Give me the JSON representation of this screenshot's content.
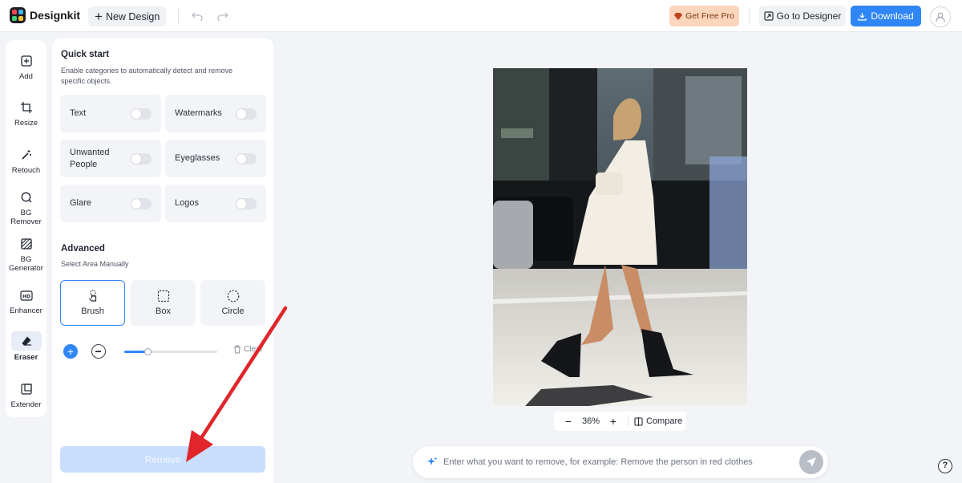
{
  "app": {
    "name": "Designkit"
  },
  "topbar": {
    "new_design_label": "New Design",
    "get_pro_label": "Get Free Pro",
    "go_to_designer_label": "Go to Designer",
    "download_label": "Download"
  },
  "rail": {
    "items": [
      {
        "label": "Add",
        "icon": "add-square-icon"
      },
      {
        "label": "Resize",
        "icon": "crop-icon"
      },
      {
        "label": "Retouch",
        "icon": "magic-wand-icon"
      },
      {
        "label": "BG Remover",
        "icon": "bg-remover-icon"
      },
      {
        "label": "BG Generator",
        "icon": "bg-generator-icon"
      },
      {
        "label": "Enhancer",
        "icon": "hd-icon"
      },
      {
        "label": "Eraser",
        "icon": "eraser-icon",
        "active": true
      },
      {
        "label": "Extender",
        "icon": "extender-icon"
      }
    ]
  },
  "panel": {
    "quick_start_title": "Quick start",
    "quick_start_desc": "Enable categories to automatically detect and remove specific objects.",
    "categories": [
      {
        "label": "Text",
        "enabled": false
      },
      {
        "label": "Watermarks",
        "enabled": false
      },
      {
        "label": "Unwanted People",
        "enabled": false
      },
      {
        "label": "Eyeglasses",
        "enabled": false
      },
      {
        "label": "Glare",
        "enabled": false
      },
      {
        "label": "Logos",
        "enabled": false
      }
    ],
    "advanced_title": "Advanced",
    "advanced_desc": "Select Area Manually",
    "modes": [
      {
        "label": "Brush",
        "icon": "hand-brush-icon",
        "active": true
      },
      {
        "label": "Box",
        "icon": "dashed-square-icon"
      },
      {
        "label": "Circle",
        "icon": "dashed-circle-icon"
      }
    ],
    "brush_size_fraction": 0.25,
    "clear_label": "Clear",
    "remove_label": "Remove"
  },
  "canvas": {
    "zoom_label": "36%",
    "compare_label": "Compare"
  },
  "prompt": {
    "placeholder": "Enter what you want to remove, for example: Remove the person in red clothes"
  },
  "colors": {
    "accent": "#2f86f6",
    "pro": "#fcd5bd",
    "annotation_arrow": "#e0262b"
  }
}
